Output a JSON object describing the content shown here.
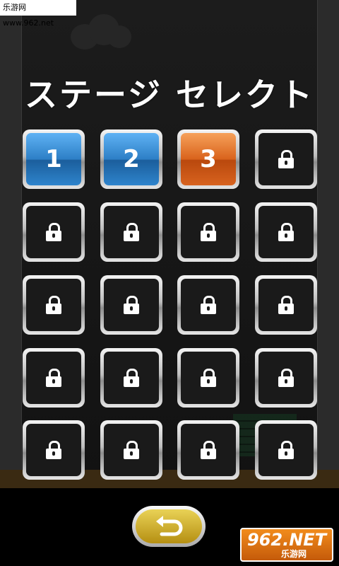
{
  "watermark": "乐游网 www.962.net",
  "title": "ステージ セレクト",
  "stages": [
    {
      "label": "1",
      "state": "unlocked",
      "color": "blue"
    },
    {
      "label": "2",
      "state": "unlocked",
      "color": "blue"
    },
    {
      "label": "3",
      "state": "unlocked",
      "color": "orange"
    },
    {
      "label": "",
      "state": "locked",
      "color": "dark"
    },
    {
      "label": "",
      "state": "locked",
      "color": "dark"
    },
    {
      "label": "",
      "state": "locked",
      "color": "dark"
    },
    {
      "label": "",
      "state": "locked",
      "color": "dark"
    },
    {
      "label": "",
      "state": "locked",
      "color": "dark"
    },
    {
      "label": "",
      "state": "locked",
      "color": "dark"
    },
    {
      "label": "",
      "state": "locked",
      "color": "dark"
    },
    {
      "label": "",
      "state": "locked",
      "color": "dark"
    },
    {
      "label": "",
      "state": "locked",
      "color": "dark"
    },
    {
      "label": "",
      "state": "locked",
      "color": "dark"
    },
    {
      "label": "",
      "state": "locked",
      "color": "dark"
    },
    {
      "label": "",
      "state": "locked",
      "color": "dark"
    },
    {
      "label": "",
      "state": "locked",
      "color": "dark"
    },
    {
      "label": "",
      "state": "locked",
      "color": "dark"
    },
    {
      "label": "",
      "state": "locked",
      "color": "dark"
    },
    {
      "label": "",
      "state": "locked",
      "color": "dark"
    },
    {
      "label": "",
      "state": "locked",
      "color": "dark"
    }
  ],
  "back_icon": "back-arrow-icon",
  "logo": {
    "brand": "962.NET",
    "sub": "乐游网"
  },
  "colors": {
    "blue": "#2d7fc6",
    "orange": "#d9631c",
    "back_button": "#d4b42a"
  }
}
